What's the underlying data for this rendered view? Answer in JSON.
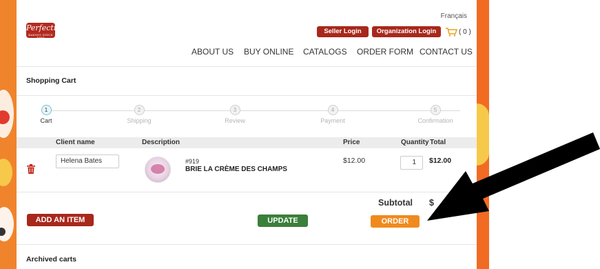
{
  "header": {
    "language_link": "Français",
    "logo_text": "Perfection",
    "logo_tagline": "BAKING SINCE 1950",
    "seller_login": "Seller Login",
    "organization_login": "Organization Login",
    "cart_count": "( 0 )"
  },
  "nav": [
    "ABOUT US",
    "BUY ONLINE",
    "CATALOGS",
    "ORDER FORM",
    "CONTACT US"
  ],
  "page_title": "Shopping Cart",
  "steps": [
    {
      "num": "1",
      "label": "Cart",
      "active": true
    },
    {
      "num": "2",
      "label": "Shipping",
      "active": false
    },
    {
      "num": "3",
      "label": "Review",
      "active": false
    },
    {
      "num": "4",
      "label": "Payment",
      "active": false
    },
    {
      "num": "5",
      "label": "Confirmation",
      "active": false
    }
  ],
  "table": {
    "headers": {
      "client_name": "Client name",
      "description": "Description",
      "price": "Price",
      "quantity": "Quantity",
      "total": "Total"
    },
    "rows": [
      {
        "client_name": "Helena Bates",
        "sku": "#919",
        "product_name": "BRIE LA CRÈME DES CHAMPS",
        "price": "$12.00",
        "quantity": "1",
        "total": "$12.00"
      }
    ]
  },
  "summary": {
    "subtotal_label": "Subtotal",
    "subtotal_value": "$"
  },
  "buttons": {
    "add_item": "ADD AN ITEM",
    "update": "UPDATE",
    "order": "ORDER"
  },
  "archived_title": "Archived carts",
  "colors": {
    "brand_red": "#a8281c",
    "update_green": "#3a7f3a",
    "order_orange": "#f08a1f",
    "step_active": "#6ec3d9"
  }
}
